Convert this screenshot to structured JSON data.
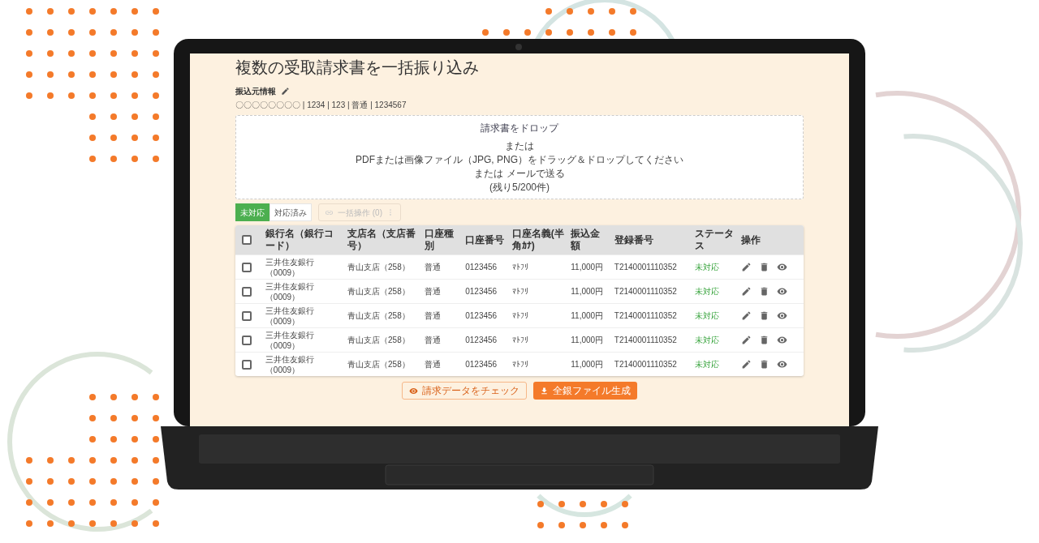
{
  "title": "複数の受取請求書を一括振り込み",
  "source_info": {
    "label": "振込元情報",
    "details": "〇〇〇〇〇〇〇〇 | 1234 | 123 | 普通 | 1234567"
  },
  "dropzone": {
    "title": "請求書をドロップ",
    "lines": [
      "または",
      "PDFまたは画像ファイル（JPG, PNG）をドラッグ＆ドロップしてください",
      "または メールで送る",
      "(残り5/200件)"
    ]
  },
  "tabs": [
    {
      "label": "未対応",
      "selected": true
    },
    {
      "label": "対応済み",
      "selected": false
    }
  ],
  "bulk_action": {
    "label": "一括操作 (0)",
    "disabled": true
  },
  "table": {
    "header_checked": false,
    "columns": [
      "銀行名（銀行コード）",
      "支店名（支店番号）",
      "口座種別",
      "口座番号",
      "口座名義(半角ｶﾅ)",
      "振込金額",
      "登録番号",
      "ステータス",
      "操作"
    ],
    "rows": [
      {
        "checked": false,
        "cells": [
          "三井住友銀行（0009）",
          "青山支店（258）",
          "普通",
          "0123456",
          "ﾏﾄﾌﾘ",
          "11,000円",
          "T2140001110352",
          "未対応"
        ]
      },
      {
        "checked": false,
        "cells": [
          "三井住友銀行（0009）",
          "青山支店（258）",
          "普通",
          "0123456",
          "ﾏﾄﾌﾘ",
          "11,000円",
          "T2140001110352",
          "未対応"
        ]
      },
      {
        "checked": false,
        "cells": [
          "三井住友銀行（0009）",
          "青山支店（258）",
          "普通",
          "0123456",
          "ﾏﾄﾌﾘ",
          "11,000円",
          "T2140001110352",
          "未対応"
        ]
      },
      {
        "checked": false,
        "cells": [
          "三井住友銀行（0009）",
          "青山支店（258）",
          "普通",
          "0123456",
          "ﾏﾄﾌﾘ",
          "11,000円",
          "T2140001110352",
          "未対応"
        ]
      },
      {
        "checked": false,
        "cells": [
          "三井住友銀行（0009）",
          "青山支店（258）",
          "普通",
          "0123456",
          "ﾏﾄﾌﾘ",
          "11,000円",
          "T2140001110352",
          "未対応"
        ]
      }
    ]
  },
  "buttons": [
    {
      "label": "請求データをチェック",
      "kind": "outline"
    },
    {
      "label": "全銀ファイル生成",
      "kind": "primary"
    }
  ]
}
